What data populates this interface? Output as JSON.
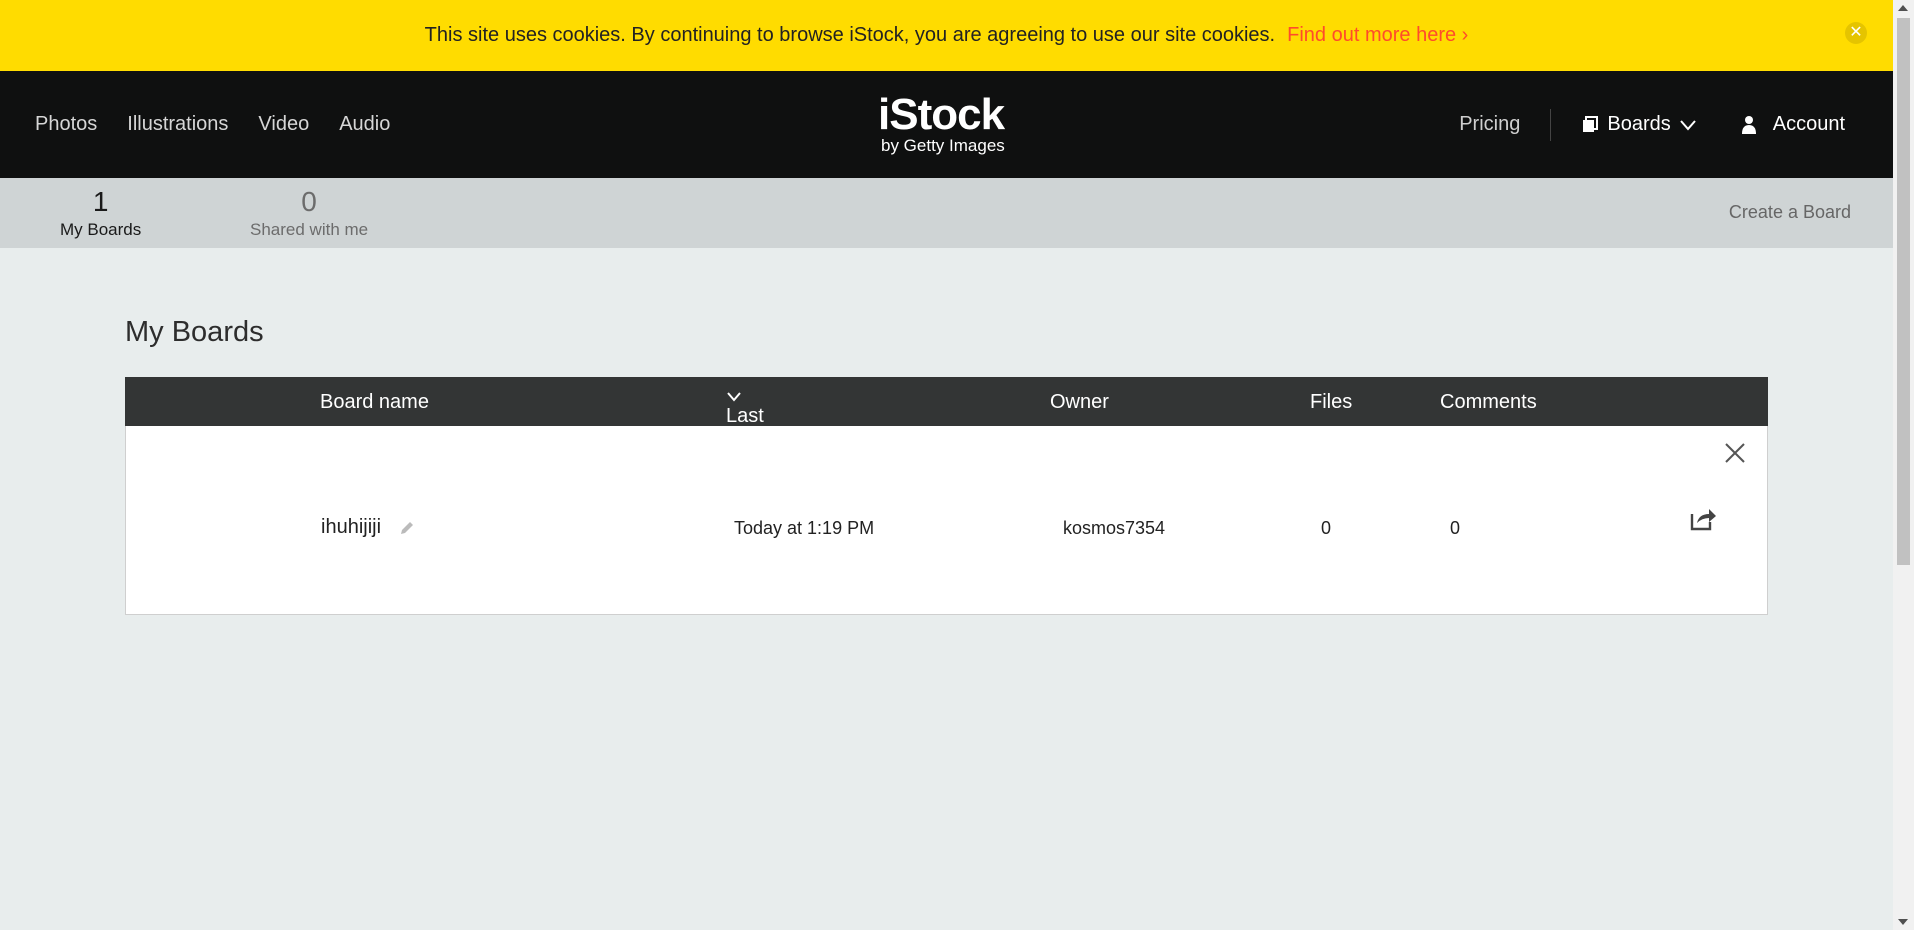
{
  "cookie_banner": {
    "message": "This site uses cookies. By continuing to browse iStock, you are agreeing to use our site cookies.",
    "link": "Find out more here ›",
    "close_icon": "close-circle-icon"
  },
  "header": {
    "nav": [
      "Photos",
      "Illustrations",
      "Video",
      "Audio"
    ],
    "logo": {
      "brand": "iStock",
      "tagline": "by Getty Images"
    },
    "pricing": "Pricing",
    "boards": "Boards",
    "account": "Account"
  },
  "subbar": {
    "my_boards": {
      "count": "1",
      "label": "My Boards"
    },
    "shared": {
      "count": "0",
      "label": "Shared with me"
    },
    "create": "Create a Board"
  },
  "main": {
    "title": "My Boards",
    "columns": {
      "name": "Board name",
      "updated": "Last updated",
      "owner": "Owner",
      "files": "Files",
      "comments": "Comments"
    },
    "rows": [
      {
        "name": "ihuhijiji",
        "updated": "Today at 1:19 PM",
        "owner": "kosmos7354",
        "files": "0",
        "comments": "0"
      }
    ]
  },
  "colors": {
    "banner": "#ffdc00",
    "link": "#ff4b2b",
    "header": "#0f1010"
  }
}
